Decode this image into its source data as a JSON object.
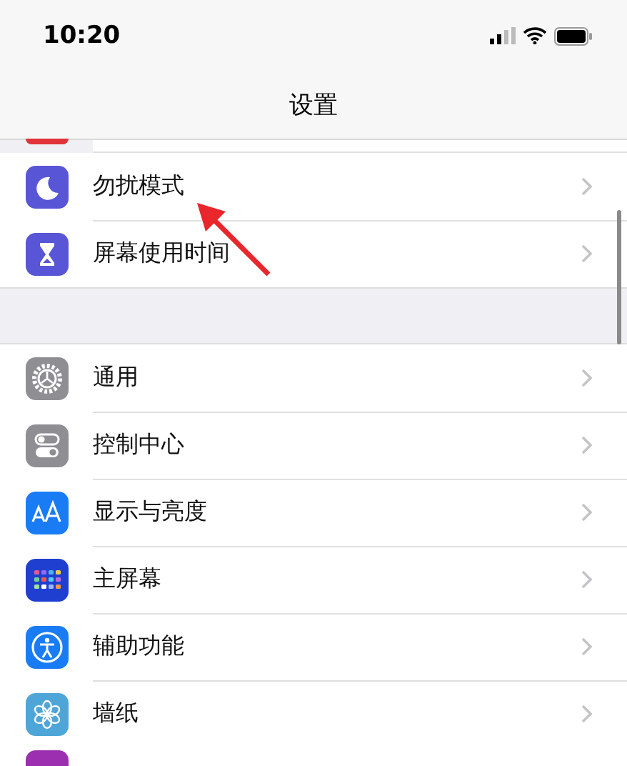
{
  "status_bar": {
    "time": "10:20"
  },
  "nav_bar": {
    "title": "设置"
  },
  "groups": [
    {
      "rows": [
        {
          "label": "勿扰模式",
          "kind": "moon"
        },
        {
          "label": "屏幕使用时间",
          "kind": "hourglass"
        }
      ]
    },
    {
      "rows": [
        {
          "label": "通用",
          "kind": "gear"
        },
        {
          "label": "控制中心",
          "kind": "toggles"
        },
        {
          "label": "显示与亮度",
          "kind": "textsize"
        },
        {
          "label": "主屏幕",
          "kind": "grid"
        },
        {
          "label": "辅助功能",
          "kind": "accessibility"
        },
        {
          "label": "墙纸",
          "kind": "flower"
        }
      ]
    }
  ],
  "annotation": {
    "kind": "arrow"
  }
}
